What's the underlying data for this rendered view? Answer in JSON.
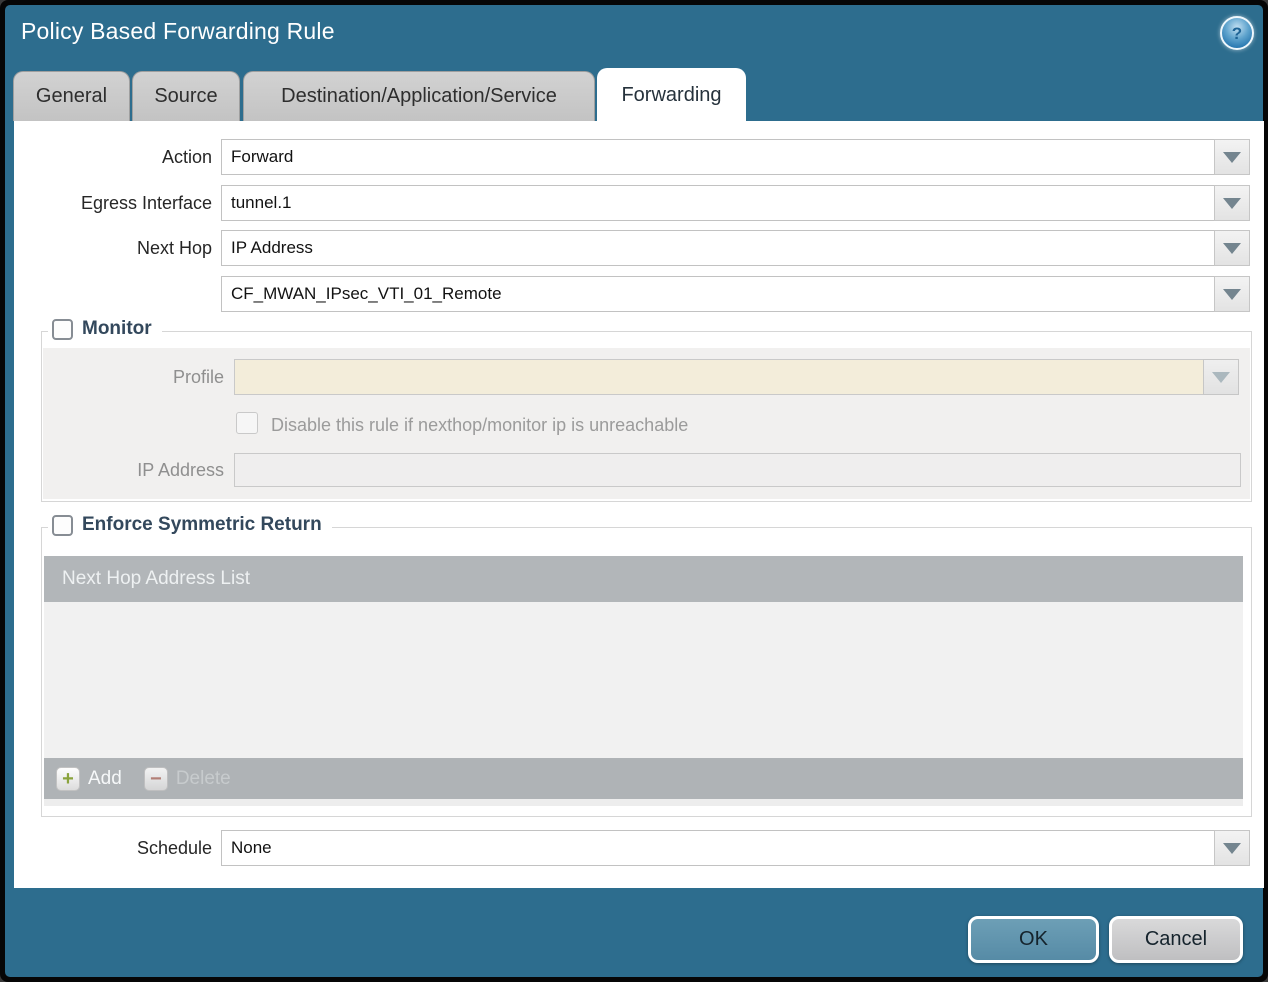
{
  "dialog": {
    "title": "Policy Based Forwarding Rule",
    "tabs": [
      {
        "label": "General",
        "active": false
      },
      {
        "label": "Source",
        "active": false
      },
      {
        "label": "Destination/Application/Service",
        "active": false
      },
      {
        "label": "Forwarding",
        "active": true
      }
    ]
  },
  "form": {
    "action": {
      "label": "Action",
      "value": "Forward"
    },
    "egress_interface": {
      "label": "Egress Interface",
      "value": "tunnel.1"
    },
    "next_hop": {
      "label": "Next Hop",
      "value": "IP Address"
    },
    "next_hop_address": {
      "value": "CF_MWAN_IPsec_VTI_01_Remote"
    },
    "schedule": {
      "label": "Schedule",
      "value": "None"
    }
  },
  "monitor": {
    "legend": "Monitor",
    "checked": false,
    "profile": {
      "label": "Profile",
      "value": ""
    },
    "disable_rule": {
      "label": "Disable this rule if nexthop/monitor ip is unreachable",
      "checked": false
    },
    "ip_address": {
      "label": "IP Address",
      "value": ""
    }
  },
  "enforce_symmetric_return": {
    "legend": "Enforce Symmetric Return",
    "checked": false,
    "table": {
      "header": "Next Hop Address List",
      "rows": []
    },
    "add_label": "Add",
    "delete_label": "Delete"
  },
  "footer": {
    "ok_label": "OK",
    "cancel_label": "Cancel"
  },
  "icons": {
    "help": "?",
    "add": "+",
    "delete": "−"
  },
  "colors": {
    "dialog_teal": "#2d6d8e",
    "active_tab_text": "#26323c",
    "legend_text": "#33485c",
    "profile_field_cream": "#f3edda",
    "table_header_grey": "#b2b6b9",
    "add_plus_green": "#8aa33c",
    "delete_minus_red": "#b3766b",
    "ok_button_fill": "#5e93ad",
    "cancel_button_fill": "#c9c9ca"
  }
}
